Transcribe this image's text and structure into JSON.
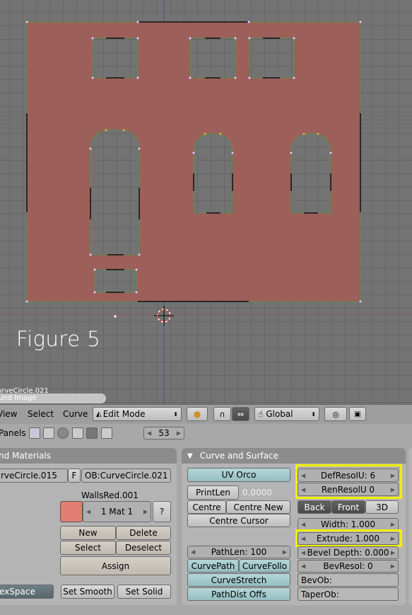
{
  "viewport": {
    "figure_label": "Figure 5",
    "object_info": "urveCircle.021",
    "tab_label": "und Image"
  },
  "header": {
    "menus": [
      "View",
      "Select",
      "Curve"
    ],
    "mode": "Edit Mode",
    "orientation": "Global"
  },
  "panels_bar": {
    "label": "Panels",
    "frame": "53"
  },
  "materials_panel": {
    "title": "nd Materials",
    "me_name": "rveCircle.015",
    "f_label": "F",
    "ob_name": "OB:CurveCircle.021",
    "material_name": "WallsRed.001",
    "material_color": "#e07f72",
    "mat_index": "1 Mat 1",
    "question": "?",
    "buttons": {
      "new": "New",
      "delete": "Delete",
      "select": "Select",
      "deselect": "Deselect",
      "assign": "Assign"
    },
    "texspace": "exSpace",
    "set_smooth": "Set Smooth",
    "set_solid": "Set Solid"
  },
  "curve_panel": {
    "title": "Curve and Surface",
    "uv_orco": "UV Orco",
    "printlen": "PrintLen",
    "printlen_value": "0.0000",
    "centre": "Centre",
    "centre_new": "Centre New",
    "centre_cursor": "Centre Cursor",
    "defresolu": "DefResolU: 6",
    "renresolu": "RenResolU 0",
    "back": "Back",
    "front": "Front",
    "three_d": "3D",
    "width": "Width: 1.000",
    "extrude": "Extrude: 1.000",
    "bevel_depth": "Bevel Depth: 0.000",
    "bevresol": "BevResol: 0",
    "bevob": "BevOb:",
    "taperob": "TaperOb:",
    "pathlen": "PathLen: 100",
    "curvepath": "CurvePath",
    "curvefollow": "CurveFollo",
    "curvestretch": "CurveStretch",
    "pathdist": "PathDist Offs"
  }
}
